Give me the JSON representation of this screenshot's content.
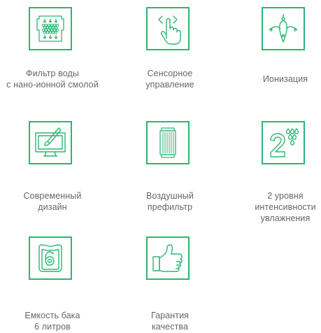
{
  "accent_color": "#2bb673",
  "features": [
    {
      "icon": "water-filter-icon",
      "label": "Фильтр воды\nс нано-ионной смолой"
    },
    {
      "icon": "touch-control-icon",
      "label": "Сенсорное\nуправление"
    },
    {
      "icon": "ionization-icon",
      "label": "Ионизация"
    },
    {
      "icon": "modern-design-icon",
      "label": "Современный\nдизайн"
    },
    {
      "icon": "air-prefilter-icon",
      "label": "Воздушный\nпрефильтр"
    },
    {
      "icon": "humidity-levels-icon",
      "label": "2 уровня\nинтенсивности\nувлажнения"
    },
    {
      "icon": "tank-capacity-icon",
      "label": "Емкость бака\n6 литров"
    },
    {
      "icon": "quality-guarantee-icon",
      "label": "Гарантия\nкачества"
    }
  ]
}
